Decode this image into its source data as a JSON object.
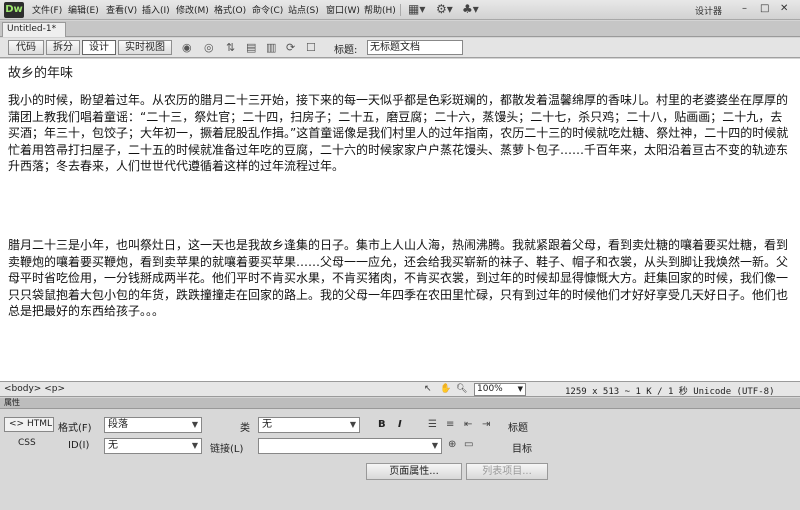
{
  "app": {
    "logo": "Dw",
    "designer": "设计器"
  },
  "menu": [
    "文件(F)",
    "编辑(E)",
    "查看(V)",
    "插入(I)",
    "修改(M)",
    "格式(O)",
    "命令(C)",
    "站点(S)",
    "窗口(W)",
    "帮助(H)"
  ],
  "window_controls": {
    "minimize": "–",
    "maximize": "□",
    "close": "✕"
  },
  "tab": {
    "name": "Untitled-1*"
  },
  "doc_toolbar": {
    "code": "代码",
    "split": "拆分",
    "design": "设计",
    "live": "实时视图",
    "title_label": "标题:",
    "title_value": "无标题文档"
  },
  "document": {
    "heading": "故乡的年味",
    "para1": "我小的时候，盼望着过年。从农历的腊月二十三开始，接下来的每一天似乎都是色彩斑斓的，都散发着温馨绵厚的香味儿。村里的老婆婆坐在厚厚的蒲团上教我们唱着童谣：“二十三，祭灶官；二十四，扫房子；二十五，磨豆腐；二十六，蒸馒头；二十七，杀只鸡；二十八，贴画画；二十九，去买酒；年三十，包饺子；大年初一，撅着屁股乱作揖。”这首童谣像是我们村里人的过年指南，农历二十三的时候就吃灶糖、祭灶神，二十四的时候就忙着用笤帚打扫屋子，二十五的时候就准备过年吃的豆腐，二十六的时候家家户户蒸花馒头、蒸萝卜包子……千百年来，太阳沿着亘古不变的轨迹东升西落；冬去春来，人们世世代代遵循着这样的过年流程过年。",
    "para2": "腊月二十三是小年，也叫祭灶日，这一天也是我故乡逢集的日子。集市上人山人海，热闹沸腾。我就紧跟着父母，看到卖灶糖的嚷着要买灶糖，看到卖鞭炮的嚷着要买鞭炮，看到卖苹果的就嚷着要买苹果……父母一一应允，还会给我买崭新的袜子、鞋子、帽子和衣裳，从头到脚让我焕然一新。父母平时省吃俭用，一分钱掰成两半花。他们平时不肯买水果，不肯买猪肉，不肯买衣裳，到过年的时候却显得慷慨大方。赶集回家的时候，我们像一只只袋鼠抱着大包小包的年货，跌跌撞撞走在回家的路上。我的父母一年四季在农田里忙碌，只有到过年的时候他们才好好享受几天好日子。他们也总是把最好的东西给孩子。。。"
  },
  "status": {
    "tags": "<body> <p>",
    "zoom": "100%",
    "info": "1259 x 513 ~ 1 K / 1 秒 Unicode (UTF-8)"
  },
  "props": {
    "header": "属性",
    "html_btn": "<> HTML",
    "css_btn": "CSS",
    "format_label": "格式(F)",
    "format_value": "段落",
    "class_label": "类",
    "class_value": "无",
    "id_label": "ID(I)",
    "id_value": "无",
    "link_label": "链接(L)",
    "link_value": "",
    "bold": "B",
    "italic": "I",
    "title_label": "标题",
    "target_label": "目标",
    "page_props": "页面属性...",
    "list_item": "列表项目..."
  }
}
